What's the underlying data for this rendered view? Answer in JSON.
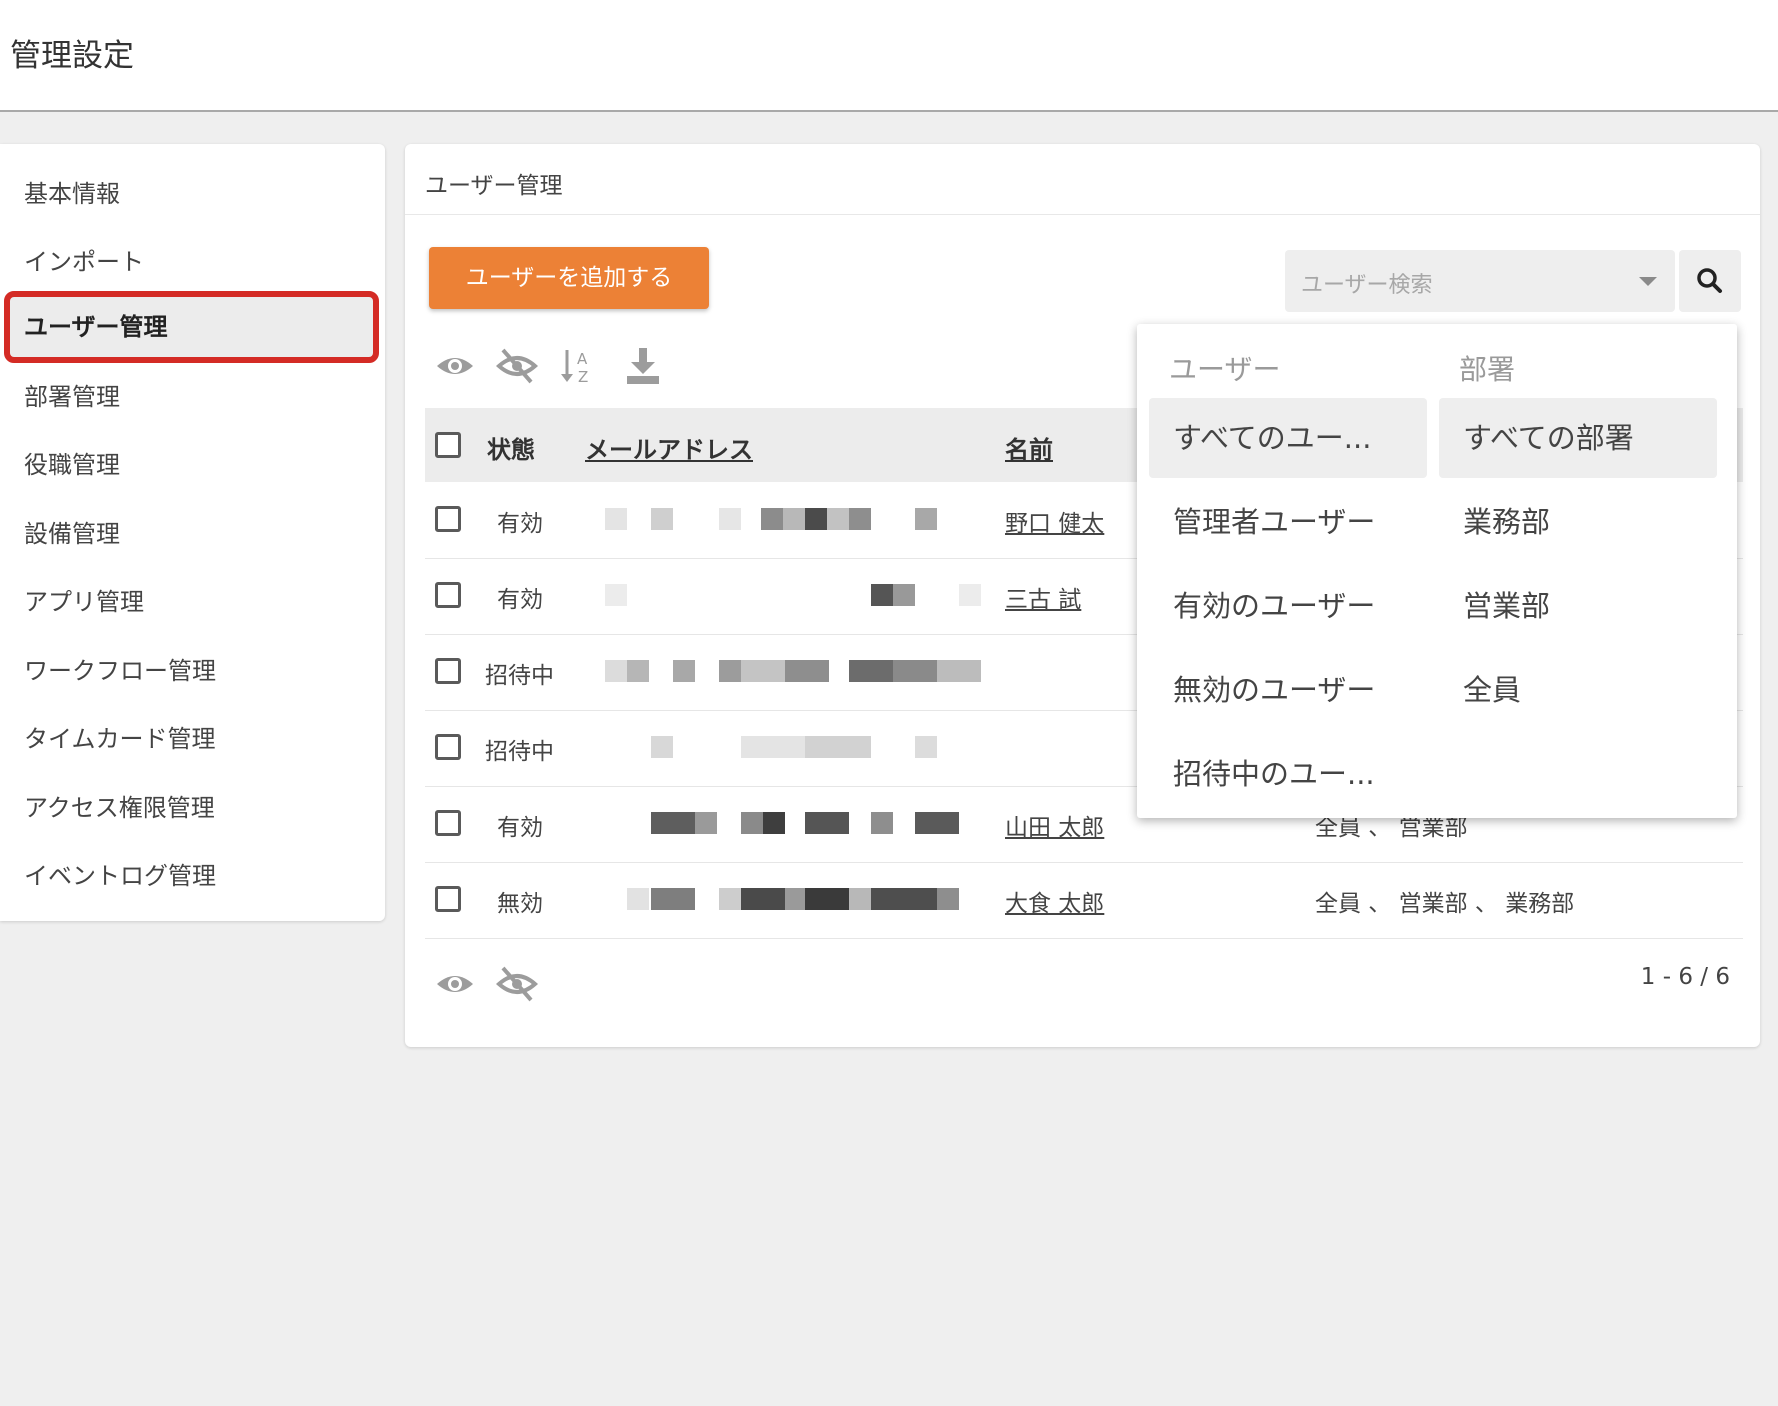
{
  "header": {
    "title": "管理設定"
  },
  "sidebar": {
    "items": [
      {
        "label": "基本情報"
      },
      {
        "label": "インポート"
      },
      {
        "label": "ユーザー管理"
      },
      {
        "label": "部署管理"
      },
      {
        "label": "役職管理"
      },
      {
        "label": "設備管理"
      },
      {
        "label": "アプリ管理"
      },
      {
        "label": "ワークフロー管理"
      },
      {
        "label": "タイムカード管理"
      },
      {
        "label": "アクセス権限管理"
      },
      {
        "label": "イベントログ管理"
      }
    ],
    "active_index": 2
  },
  "main": {
    "title": "ユーザー管理",
    "add_button_label": "ユーザーを追加する",
    "search": {
      "placeholder": "ユーザー検索"
    },
    "toolbar_icons": [
      "eye-icon",
      "eye-off-icon",
      "sort-az-icon",
      "download-icon"
    ],
    "table": {
      "columns": [
        "状態",
        "メールアドレス",
        "名前"
      ],
      "rows": [
        {
          "status": "有効",
          "name": "野口 健太",
          "dept": ""
        },
        {
          "status": "有効",
          "name": "三古 試",
          "dept": ""
        },
        {
          "status": "招待中",
          "name": "",
          "dept": ""
        },
        {
          "status": "招待中",
          "name": "",
          "dept": ""
        },
        {
          "status": "有効",
          "name": "山田 太郎",
          "dept": "全員 、 営業部"
        },
        {
          "status": "無効",
          "name": "大食 太郎",
          "dept": "全員 、 営業部 、 業務部"
        }
      ]
    },
    "footer_icons": [
      "eye-icon",
      "eye-off-icon"
    ],
    "pagination": "1 - 6 / 6"
  },
  "dropdown": {
    "user_column_title": "ユーザー",
    "dept_column_title": "部署",
    "user_items": [
      "すべてのユー...",
      "管理者ユーザー",
      "有効のユーザー",
      "無効のユーザー",
      "招待中のユー..."
    ],
    "dept_items": [
      "すべての部署",
      "業務部",
      "営業部",
      "全員"
    ],
    "selected_user_index": 0,
    "selected_dept_index": 0
  },
  "colors": {
    "accent": "#ec8136",
    "highlight": "#d42b25",
    "background": "#efefef"
  }
}
